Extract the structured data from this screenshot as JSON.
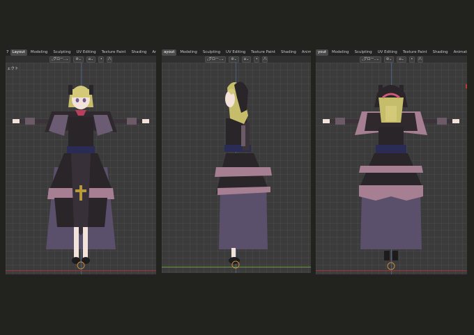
{
  "panels": [
    {
      "id": "front",
      "corner_number": "7",
      "side_label": "ェクト",
      "tabs": [
        "Layout",
        "Modeling",
        "Sculpting",
        "UV Editing",
        "Texture Paint",
        "Shading",
        "Anim"
      ],
      "active_tab": 0,
      "header": {
        "orientation": "グロー..",
        "snap": "",
        "proportional": "",
        "overlay": "",
        "shading": "八"
      }
    },
    {
      "id": "side",
      "tabs": [
        "ayout",
        "Modeling",
        "Sculpting",
        "UV Editing",
        "Texture Paint",
        "Shading",
        "Animation"
      ],
      "active_tab": 0,
      "header": {
        "orientation": "グロー..",
        "snap": "",
        "proportional": "",
        "overlay": "",
        "shading": "八"
      }
    },
    {
      "id": "back",
      "tabs": [
        "yout",
        "Modeling",
        "Sculpting",
        "UV Editing",
        "Texture Paint",
        "Shading",
        "Animation"
      ],
      "active_tab": 0,
      "header": {
        "orientation": "グロー..",
        "snap": "",
        "proportional": "",
        "overlay": "",
        "shading": "八"
      }
    }
  ],
  "colors": {
    "background": "#22221e",
    "viewport": "#3b3b3b",
    "x_axis": "#a0323a",
    "y_axis": "#6a9a3a",
    "dress_black": "#2a2528",
    "dress_ruffle": "#a77f93",
    "skirt_purple": "#5a506c",
    "ribbon_navy": "#2b2c55",
    "hair_blonde": "#c6bd6a",
    "skin": "#f3e2da"
  },
  "icons": [
    "transform-pivot-icon",
    "snap-icon",
    "magnet-icon",
    "overlay-icon",
    "shading-icon"
  ]
}
